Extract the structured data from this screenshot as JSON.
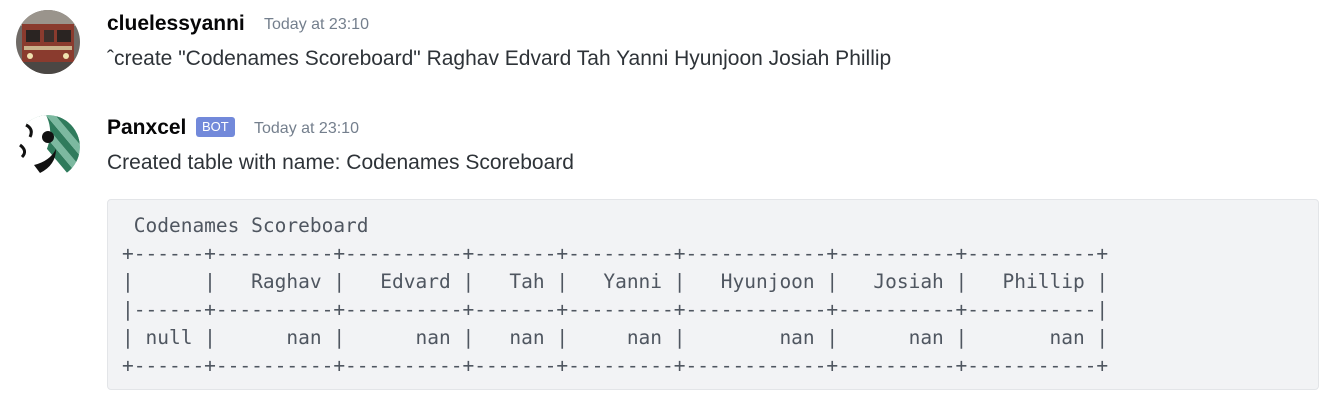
{
  "messages": [
    {
      "author": "cluelessyanni",
      "timestamp": "Today at 23:10",
      "text": "ˆcreate \"Codenames Scoreboard\" Raghav Edvard Tah Yanni Hyunjoon Josiah Phillip",
      "avatar": "train-photo-avatar"
    },
    {
      "author": "Panxcel",
      "badge": "BOT",
      "timestamp": "Today at 23:10",
      "text": "Created table with name: Codenames Scoreboard",
      "avatar": "bot-stripes-avatar",
      "code_block": " Codenames Scoreboard\n+------+----------+----------+-------+---------+------------+----------+-----------+\n|      |   Raghav |   Edvard |   Tah |   Yanni |   Hyunjoon |   Josiah |   Phillip |\n|------+----------+----------+-------+---------+------------+----------+-----------|\n| null |      nan |      nan |   nan |     nan |        nan |      nan |       nan |\n+------+----------+----------+-------+---------+------------+----------+-----------+"
    }
  ],
  "colors": {
    "bot_badge": "#7289da",
    "timestamp": "#747f8d",
    "code_bg": "#f2f3f5"
  }
}
